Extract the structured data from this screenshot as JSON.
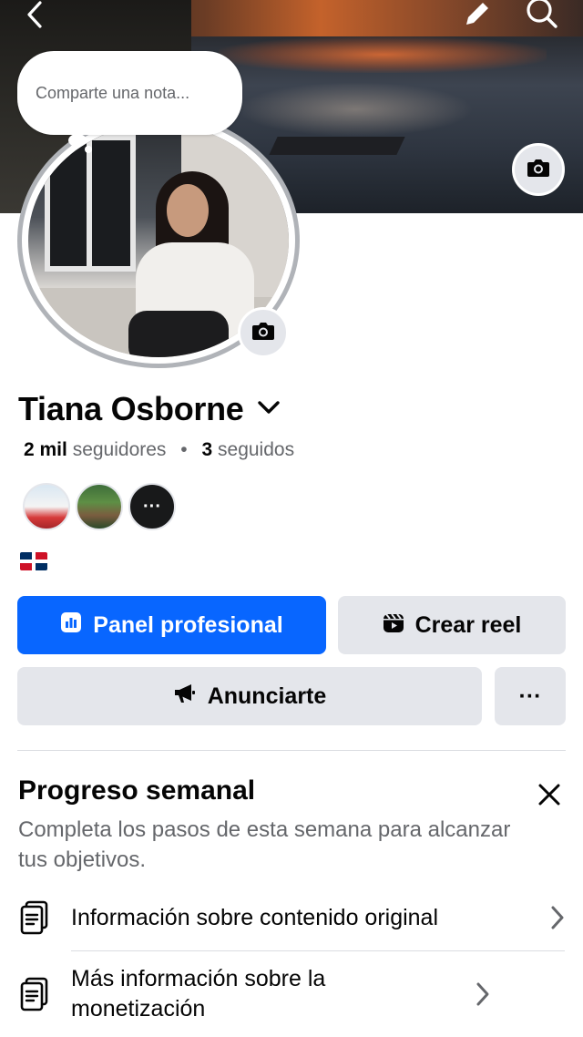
{
  "note": {
    "placeholder": "Comparte una nota..."
  },
  "profile": {
    "name": "Tiana Osborne",
    "followers_count": "2 mil",
    "followers_label": "seguidores",
    "following_count": "3",
    "following_label": "seguidos",
    "separator": "•",
    "more_friends_glyph": "···"
  },
  "actions": {
    "professional_dashboard": "Panel profesional",
    "create_reel": "Crear reel",
    "advertise": "Anunciarte",
    "more": "···"
  },
  "weekly_progress": {
    "title": "Progreso semanal",
    "description": "Completa los pasos de esta semana para alcanzar tus objetivos.",
    "items": [
      {
        "label": "Información sobre contenido original",
        "icon": "document-icon"
      },
      {
        "label": "Más información sobre la monetización",
        "icon": "document-icon"
      }
    ]
  },
  "colors": {
    "primary": "#0866ff",
    "grey_button": "#e4e6eb",
    "secondary_text": "#65676b"
  },
  "icons": [
    "back-arrow-icon",
    "edit-pencil-icon",
    "search-icon",
    "camera-icon",
    "chevron-down-icon",
    "dashboard-icon",
    "reel-icon",
    "megaphone-icon",
    "more-icon",
    "close-icon",
    "document-icon",
    "chevron-right-icon",
    "flag-dominican-republic"
  ]
}
